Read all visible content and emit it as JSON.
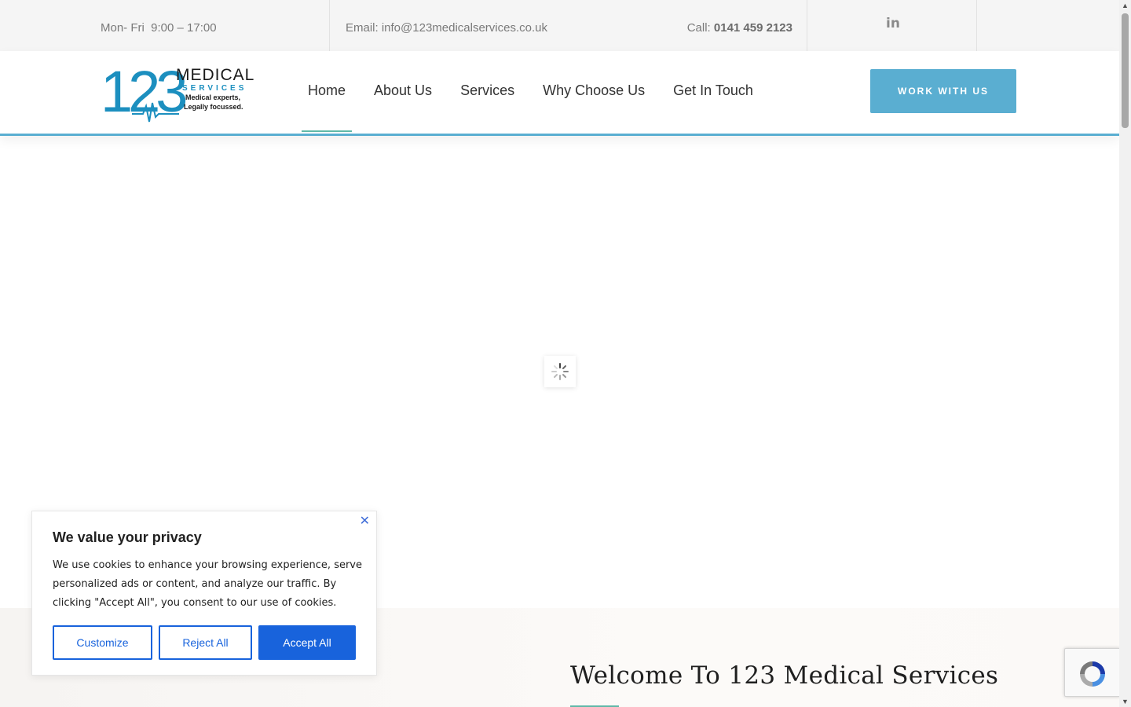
{
  "topbar": {
    "hours": "Mon- Fri  9:00 – 17:00",
    "email": "Email: info@123medicalservices.co.uk",
    "call_label": "Call:",
    "call_number": "0141 459 2123",
    "social_icon": "linkedin-icon",
    "social_text": "in"
  },
  "logo": {
    "number": "123",
    "word": "MEDICAL",
    "sub": "SERVICES",
    "tagline_1": "Medical experts,",
    "tagline_2": "Legally focussed."
  },
  "nav": {
    "items": [
      {
        "label": "Home",
        "active": true
      },
      {
        "label": "About Us"
      },
      {
        "label": "Services"
      },
      {
        "label": "Why Choose Us"
      },
      {
        "label": "Get In Touch"
      }
    ]
  },
  "cta": {
    "label": "WORK WITH US"
  },
  "welcome": {
    "heading": "Welcome To 123 Medical Services"
  },
  "cookie": {
    "title": "We value your privacy",
    "body": "We use cookies to enhance your browsing experience, serve personalized ads or content, and analyze our traffic. By clicking \"Accept All\", you consent to our use of cookies.",
    "customize": "Customize",
    "reject": "Reject All",
    "accept": "Accept All",
    "close_icon": "close-icon"
  },
  "colors": {
    "accent": "#5aaed1",
    "brand_blue": "#1c8fbf",
    "cookie_blue": "#1863dc",
    "underline_green": "#5fb8a8"
  }
}
